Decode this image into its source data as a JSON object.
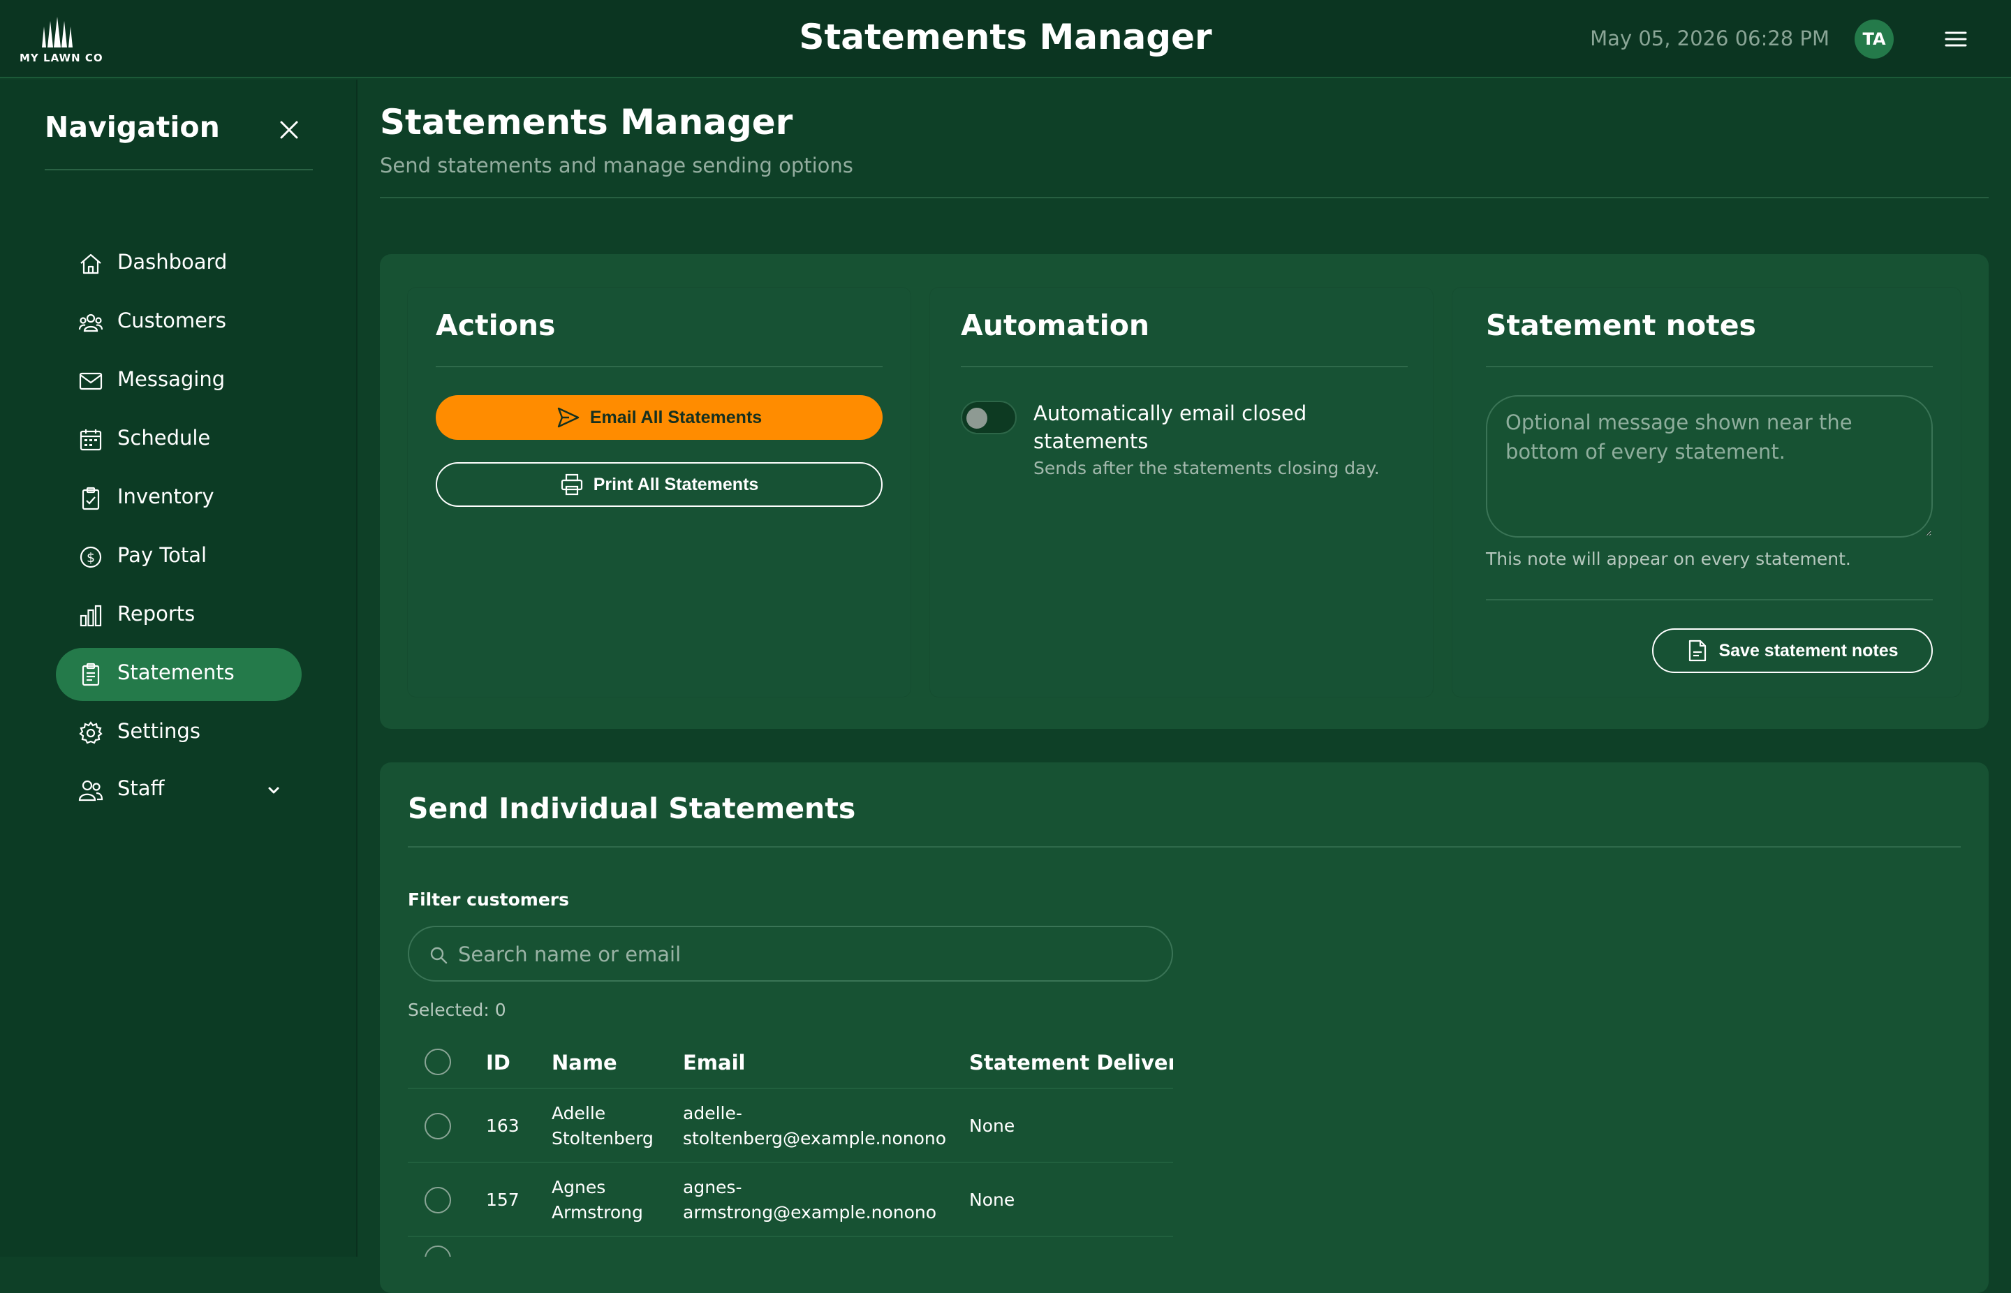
{
  "header": {
    "brand": "MY LAWN CO",
    "title": "Statements Manager",
    "datetime": "May 05, 2026 06:28 PM",
    "avatar_initials": "TA",
    "menu_icon": "hamburger-icon"
  },
  "sidebar": {
    "title": "Navigation",
    "items": [
      {
        "label": "Dashboard",
        "icon": "home-icon"
      },
      {
        "label": "Customers",
        "icon": "users-group-icon"
      },
      {
        "label": "Messaging",
        "icon": "envelope-icon"
      },
      {
        "label": "Schedule",
        "icon": "calendar-icon"
      },
      {
        "label": "Inventory",
        "icon": "clipboard-check-icon"
      },
      {
        "label": "Pay Total",
        "icon": "dollar-circle-icon"
      },
      {
        "label": "Reports",
        "icon": "bar-chart-icon"
      },
      {
        "label": "Statements",
        "icon": "clipboard-list-icon",
        "active": true
      },
      {
        "label": "Settings",
        "icon": "gear-icon"
      },
      {
        "label": "Staff",
        "icon": "people-icon",
        "expandable": true
      }
    ]
  },
  "page": {
    "title": "Statements Manager",
    "subtitle": "Send statements and manage sending options"
  },
  "actions": {
    "title": "Actions",
    "email_all": "Email All Statements",
    "print_all": "Print All Statements"
  },
  "automation": {
    "title": "Automation",
    "toggle_label": "Automatically email closed statements",
    "toggle_help": "Sends after the statements closing day.",
    "enabled": false
  },
  "notes": {
    "title": "Statement notes",
    "placeholder": "Optional message shown near the bottom of every statement.",
    "value": "",
    "help": "This note will appear on every statement.",
    "save_label": "Save statement notes"
  },
  "individual": {
    "title": "Send Individual Statements",
    "filter_label": "Filter customers",
    "search_placeholder": "Search name or email",
    "selected_text": "Selected: 0",
    "columns": [
      "ID",
      "Name",
      "Email",
      "Statement Delivery"
    ],
    "rows": [
      {
        "id": "163",
        "name": "Adelle Stoltenberg",
        "email": "adelle-stoltenberg@example.nonono",
        "delivery": "None"
      },
      {
        "id": "157",
        "name": "Agnes Armstrong",
        "email": "agnes-armstrong@example.nonono",
        "delivery": "None"
      }
    ]
  },
  "colors": {
    "background": "#0e4027",
    "card": "#175233",
    "accent": "#ff8c00",
    "active_nav": "#247a4a"
  }
}
